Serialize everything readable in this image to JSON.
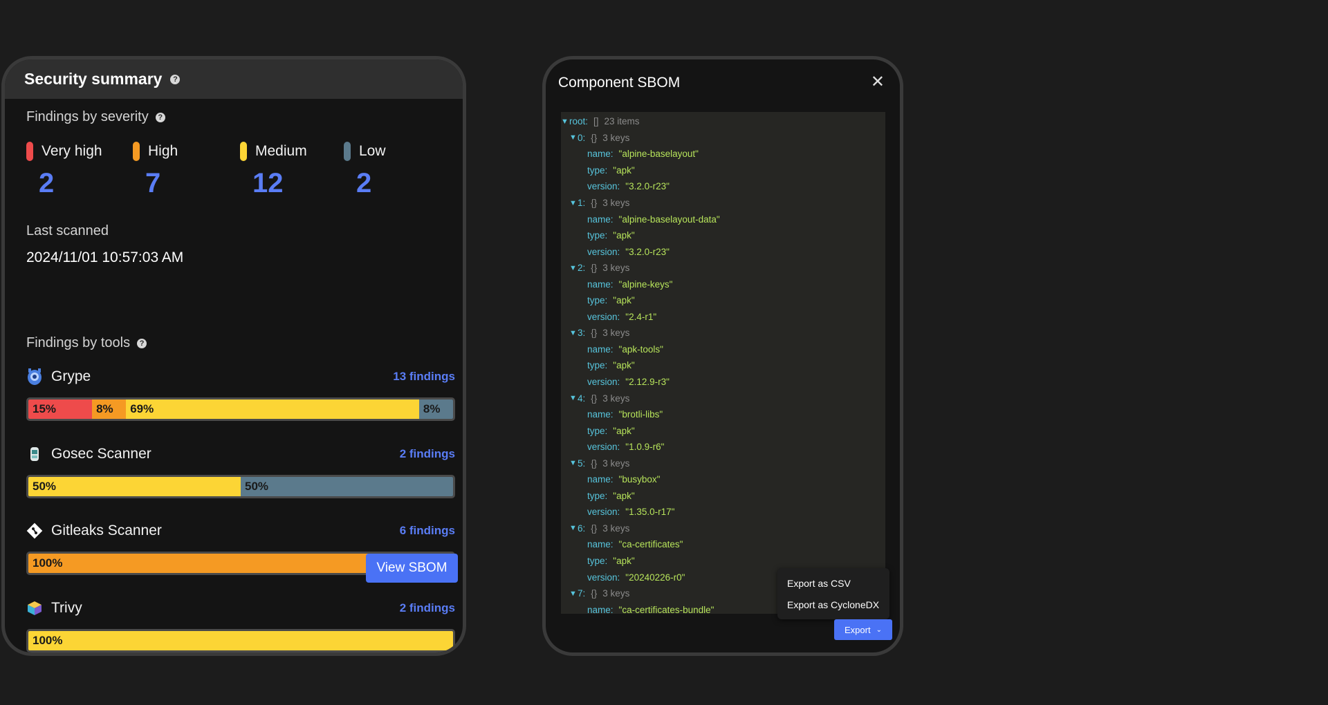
{
  "security_summary": {
    "title": "Security summary",
    "severity_label": "Findings by severity",
    "severities": [
      {
        "label": "Very high",
        "count": "2",
        "color": "#ee4b4b"
      },
      {
        "label": "High",
        "count": "7",
        "color": "#f59a23"
      },
      {
        "label": "Medium",
        "count": "12",
        "color": "#fcd535"
      },
      {
        "label": "Low",
        "count": "2",
        "color": "#5b7a8c"
      }
    ],
    "last_scanned_label": "Last scanned",
    "last_scanned_value": "2024/11/01 10:57:03 AM",
    "tools_label": "Findings by tools",
    "tools": [
      {
        "name": "Grype",
        "icon": "grype-icon",
        "findings": "13 findings",
        "segments": [
          {
            "label": "15%",
            "percent": 15,
            "color": "#ee4b4b"
          },
          {
            "label": "8%",
            "percent": 8,
            "color": "#f59a23"
          },
          {
            "label": "69%",
            "percent": 69,
            "color": "#fcd535"
          },
          {
            "label": "8%",
            "percent": 8,
            "color": "#5b7a8c"
          }
        ]
      },
      {
        "name": "Gosec Scanner",
        "icon": "gosec-icon",
        "findings": "2 findings",
        "segments": [
          {
            "label": "50%",
            "percent": 50,
            "color": "#fcd535"
          },
          {
            "label": "50%",
            "percent": 50,
            "color": "#5b7a8c"
          }
        ]
      },
      {
        "name": "Gitleaks Scanner",
        "icon": "gitleaks-icon",
        "findings": "6 findings",
        "segments": [
          {
            "label": "100%",
            "percent": 100,
            "color": "#f59a23"
          }
        ]
      },
      {
        "name": "Trivy",
        "icon": "trivy-icon",
        "findings": "2 findings",
        "segments": [
          {
            "label": "100%",
            "percent": 100,
            "color": "#fcd535"
          }
        ]
      }
    ],
    "view_sbom_label": "View SBOM"
  },
  "sbom": {
    "title": "Component SBOM",
    "close_icon": "close-icon",
    "root_key": "root:",
    "root_type": "[]",
    "root_count": "23 items",
    "items": [
      {
        "index": "0:",
        "type": "{}",
        "count": "3 keys",
        "name": "\"alpine-baselayout\"",
        "pkg_type": "\"apk\"",
        "version": "\"3.2.0-r23\""
      },
      {
        "index": "1:",
        "type": "{}",
        "count": "3 keys",
        "name": "\"alpine-baselayout-data\"",
        "pkg_type": "\"apk\"",
        "version": "\"3.2.0-r23\""
      },
      {
        "index": "2:",
        "type": "{}",
        "count": "3 keys",
        "name": "\"alpine-keys\"",
        "pkg_type": "\"apk\"",
        "version": "\"2.4-r1\""
      },
      {
        "index": "3:",
        "type": "{}",
        "count": "3 keys",
        "name": "\"apk-tools\"",
        "pkg_type": "\"apk\"",
        "version": "\"2.12.9-r3\""
      },
      {
        "index": "4:",
        "type": "{}",
        "count": "3 keys",
        "name": "\"brotli-libs\"",
        "pkg_type": "\"apk\"",
        "version": "\"1.0.9-r6\""
      },
      {
        "index": "5:",
        "type": "{}",
        "count": "3 keys",
        "name": "\"busybox\"",
        "pkg_type": "\"apk\"",
        "version": "\"1.35.0-r17\""
      },
      {
        "index": "6:",
        "type": "{}",
        "count": "3 keys",
        "name": "\"ca-certificates\"",
        "pkg_type": "\"apk\"",
        "version": "\"20240226-r0\""
      },
      {
        "index": "7:",
        "type": "{}",
        "count": "3 keys",
        "name": "\"ca-certificates-bundle\"",
        "pkg_type": null,
        "version": null
      }
    ],
    "keys": {
      "name": "name:",
      "type": "type:",
      "version": "version:"
    },
    "export_menu": [
      "Export as CSV",
      "Export as CycloneDX"
    ],
    "export_label": "Export"
  }
}
